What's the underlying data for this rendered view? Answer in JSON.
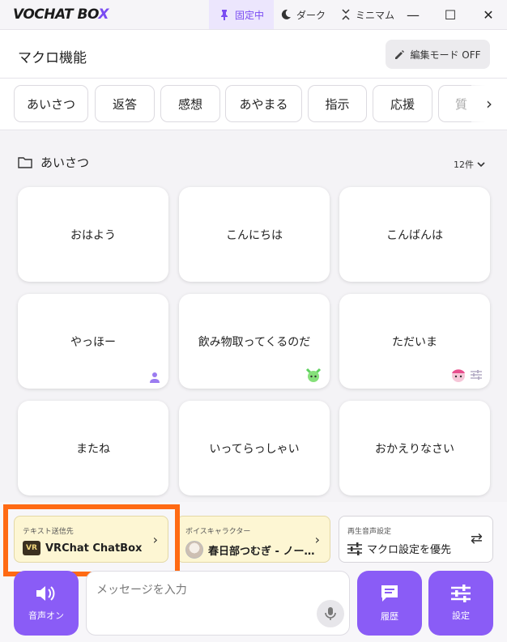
{
  "titlebar": {
    "logo_main": "VOCHAT BO",
    "logo_accent": "X",
    "pin_label": "固定中",
    "dark_label": "ダーク",
    "mini_label": "ミニマム",
    "min_glyph": "—",
    "max_glyph": "☐",
    "close_glyph": "✕"
  },
  "header": {
    "title": "マクロ機能",
    "edit_mode_label": "編集モード OFF"
  },
  "tabs": [
    "あいさつ",
    "返答",
    "感想",
    "あやまる",
    "指示",
    "応援",
    "質"
  ],
  "section": {
    "title": "あいさつ",
    "count": "12件"
  },
  "macros": [
    {
      "text": "おはよう"
    },
    {
      "text": "こんにちは"
    },
    {
      "text": "こんばんは"
    },
    {
      "text": "やっほー",
      "badge": "person-icon"
    },
    {
      "text": "飲み物取ってくるのだ",
      "badge": "character-avatar"
    },
    {
      "text": "ただいま",
      "badge": "character-avatar-and-settings"
    },
    {
      "text": "またね"
    },
    {
      "text": "いってらっしゃい"
    },
    {
      "text": "おかえりなさい"
    }
  ],
  "bottom": {
    "text_target": {
      "label": "テキスト送信先",
      "tag": "VR",
      "value": "VRChat ChatBox"
    },
    "voice_character": {
      "label": "ボイスキャラクター",
      "value": "春日部つむぎ - ノー…"
    },
    "playback": {
      "label": "再生音声設定",
      "value": "マクロ設定を優先"
    },
    "sound_button": "音声オン",
    "message_placeholder": "メッセージを入力",
    "history_button": "履歴",
    "settings_button": "設定"
  },
  "colors": {
    "accent": "#8a5cf6",
    "highlight": "#ff6a13",
    "selector_bg": "#fdf6d3"
  }
}
